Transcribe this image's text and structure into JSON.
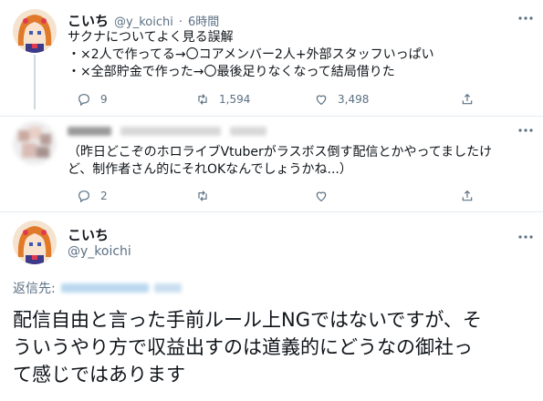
{
  "tweet1": {
    "display_name": "こいち",
    "handle": "@y_koichi",
    "separator": "·",
    "time": "6時間",
    "lines": [
      "サクナについてよく見る誤解",
      "・×2人で作ってる→〇コアメンバー2人+外部スタッフいっぱい",
      "・×全部貯金で作った→〇最後足りなくなって結局借りた"
    ],
    "replies": "9",
    "retweets": "1,594",
    "likes": "3,498"
  },
  "tweet2": {
    "lines": [
      "（昨日どこぞのホロライブVtuberがラスボス倒す配信とかやってましたけ",
      "ど、制作者さん的にそれOKなんでしょうかね...）"
    ],
    "replies": "2"
  },
  "tweet3": {
    "display_name": "こいち",
    "handle": "@y_koichi",
    "reply_to_label": "返信先:",
    "body_lines": [
      "配信自由と言った手前ルール上NGではないですが、そ",
      "ういうやり方で収益出すのは道義的にどうなの御社っ",
      "て感じではあります"
    ]
  },
  "icons": [
    "reply-icon",
    "retweet-icon",
    "like-icon",
    "share-icon",
    "more-icon"
  ],
  "colors": {
    "secondary": "#5b7083",
    "text": "#0f1419",
    "border": "#e6ecf0"
  }
}
